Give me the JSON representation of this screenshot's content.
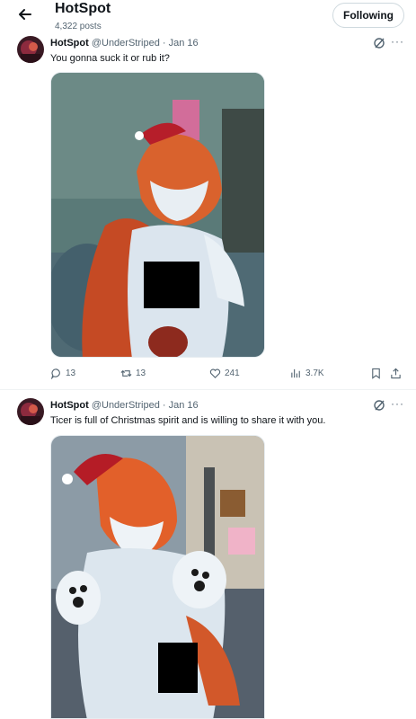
{
  "header": {
    "title": "HotSpot",
    "post_count": "4,322 posts",
    "follow_label": "Following"
  },
  "posts": [
    {
      "name": "HotSpot",
      "handle": "@UnderStriped",
      "date": "· Jan 16",
      "text": "You gonna suck it  or rub it?",
      "replies": "13",
      "reposts": "13",
      "likes": "241",
      "views": "3.7K"
    },
    {
      "name": "HotSpot",
      "handle": "@UnderStriped",
      "date": "· Jan 16",
      "text": "Ticer is full of Christmas spirit and is willing to share it with you."
    }
  ],
  "colors": {
    "text_primary": "#0f1419",
    "text_secondary": "#536471",
    "border": "#cfd9de"
  }
}
